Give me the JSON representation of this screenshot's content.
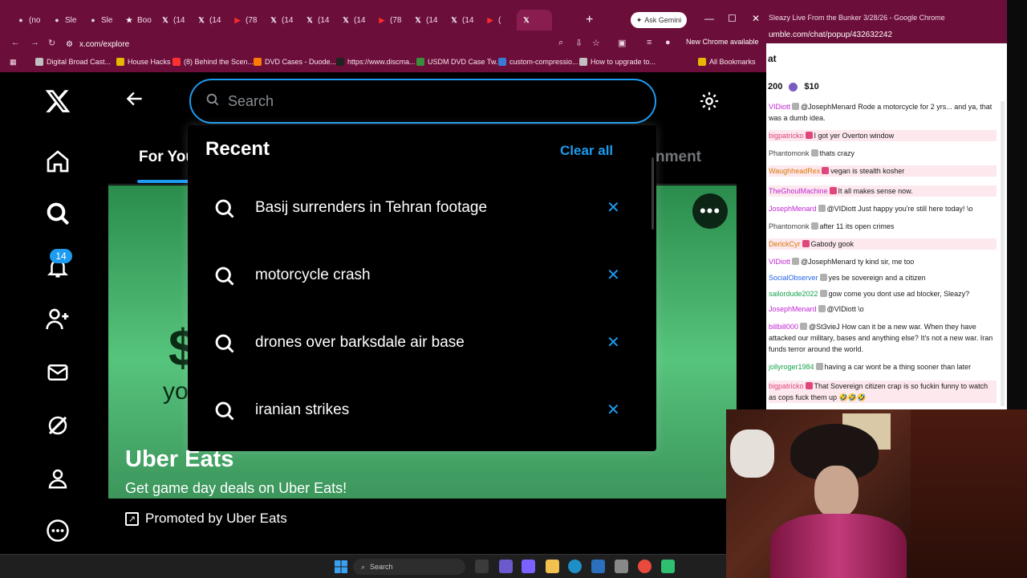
{
  "colors": {
    "accent": "#1d9bf0",
    "chrome_frame": "#6b0f3a",
    "promo_green": "#56c47c"
  },
  "browser": {
    "tabs": [
      {
        "label": "(no",
        "icon": "tab-favicon"
      },
      {
        "label": "Sle",
        "icon": "tab-favicon"
      },
      {
        "label": "Sle",
        "icon": "tab-favicon"
      },
      {
        "label": "Boo",
        "icon": "bookmark-star-icon"
      },
      {
        "label": "(14",
        "icon": "x-logo-icon"
      },
      {
        "label": "(14",
        "icon": "x-logo-icon"
      },
      {
        "label": "(78",
        "icon": "youtube-icon"
      },
      {
        "label": "(14",
        "icon": "x-logo-icon"
      },
      {
        "label": "(14",
        "icon": "x-logo-icon"
      },
      {
        "label": "(14",
        "icon": "x-logo-icon"
      },
      {
        "label": "(78",
        "icon": "youtube-icon"
      },
      {
        "label": "(14",
        "icon": "x-logo-icon"
      },
      {
        "label": "(14",
        "icon": "x-logo-icon"
      },
      {
        "label": "(",
        "icon": "youtube-icon"
      },
      {
        "label": "",
        "icon": "x-logo-icon"
      }
    ],
    "new_tab": "+",
    "gemini_label": "Ask Gemini",
    "url": "x.com/explore",
    "new_chrome": "New Chrome available",
    "bookmarks": [
      "Digital Broad Cast...",
      "House Hacks",
      "(8) Behind the Scen...",
      "DVD Cases - Duode...",
      "https://www.discma...",
      "USDM DVD Case Tw...",
      "custom-compressio...",
      "How to upgrade to...",
      "All Bookmarks"
    ]
  },
  "x": {
    "notification_count": "14",
    "search": {
      "placeholder": "Search",
      "recent_title": "Recent",
      "clear_all": "Clear all",
      "recent": [
        "Basij surrenders in Tehran footage",
        "motorcycle crash",
        "drones over barksdale air base",
        "iranian strikes"
      ]
    },
    "tabs": {
      "for_you": "For You",
      "entertainment": "nment"
    },
    "promo": {
      "big_text": "$",
      "small_text": "yo",
      "brand": "Uber Eats",
      "tagline": "Get game day deals on Uber Eats!",
      "promoted_by": "Promoted by Uber Eats",
      "more": "•••"
    }
  },
  "chat": {
    "window_title": "Sleazy Live From the Bunker 3/28/26 - Google Chrome",
    "url": "umble.com/chat/popup/432632242",
    "heading": "at",
    "stats_count": "200",
    "stats_amount": "$10",
    "messages": [
      {
        "user": "VIDiott",
        "user_color": "#c026d3",
        "text": "@JosephMenard Rode a motorcycle for 2 yrs... and ya, that was a dumb idea.",
        "highlight": false
      },
      {
        "user": "bigpatricko",
        "user_color": "#e0457b",
        "text": "I got yer Overton window",
        "highlight": true
      },
      {
        "user": "Phantomonk",
        "user_color": "#444444",
        "text": "thats crazy",
        "highlight": false
      },
      {
        "user": "WaughheadRex",
        "user_color": "#d97706",
        "text": "vegan is stealth kosher",
        "highlight": true
      },
      {
        "user": "TheGhoulMachine",
        "user_color": "#c026d3",
        "text": "It all makes sense now.",
        "highlight": true
      },
      {
        "user": "JosephMenard",
        "user_color": "#c026d3",
        "text": "@VIDiott Just happy you're still here today! \\o",
        "highlight": false
      },
      {
        "user": "Phantomonk",
        "user_color": "#444444",
        "text": "after 11 its open crimes",
        "highlight": false
      },
      {
        "user": "DerickCyr",
        "user_color": "#d97706",
        "text": "Gabody gook",
        "highlight": true
      },
      {
        "user": "VIDiott",
        "user_color": "#c026d3",
        "text": "@JosephMenard ty kind sir, me too",
        "highlight": false
      },
      {
        "user": "SocialObserver",
        "user_color": "#2563eb",
        "text": "yes be sovereign and a citizen",
        "highlight": false
      },
      {
        "user": "sailordude2022",
        "user_color": "#16a34a",
        "text": "gow come you dont use ad blocker, Sleazy?",
        "highlight": false
      },
      {
        "user": "JosephMenard",
        "user_color": "#c026d3",
        "text": "@VIDiott \\o",
        "highlight": false
      },
      {
        "user": "billbill000",
        "user_color": "#c026d3",
        "text": "@St3vieJ How can it be a new war. When they have attacked our military, bases and anything else? It's not a new war. Iran funds terror around the world.",
        "highlight": false
      },
      {
        "user": "jollyroger1984",
        "user_color": "#16a34a",
        "text": "having a car wont be a thing sooner than later",
        "highlight": false
      },
      {
        "user": "bigpatricko",
        "user_color": "#e0457b",
        "text": "That Sovereign citizen crap is so fuckin funny to watch as cops fuck them up 🤣🤣🤣",
        "highlight": true
      }
    ]
  },
  "taskbar": {
    "search_placeholder": "Search"
  }
}
